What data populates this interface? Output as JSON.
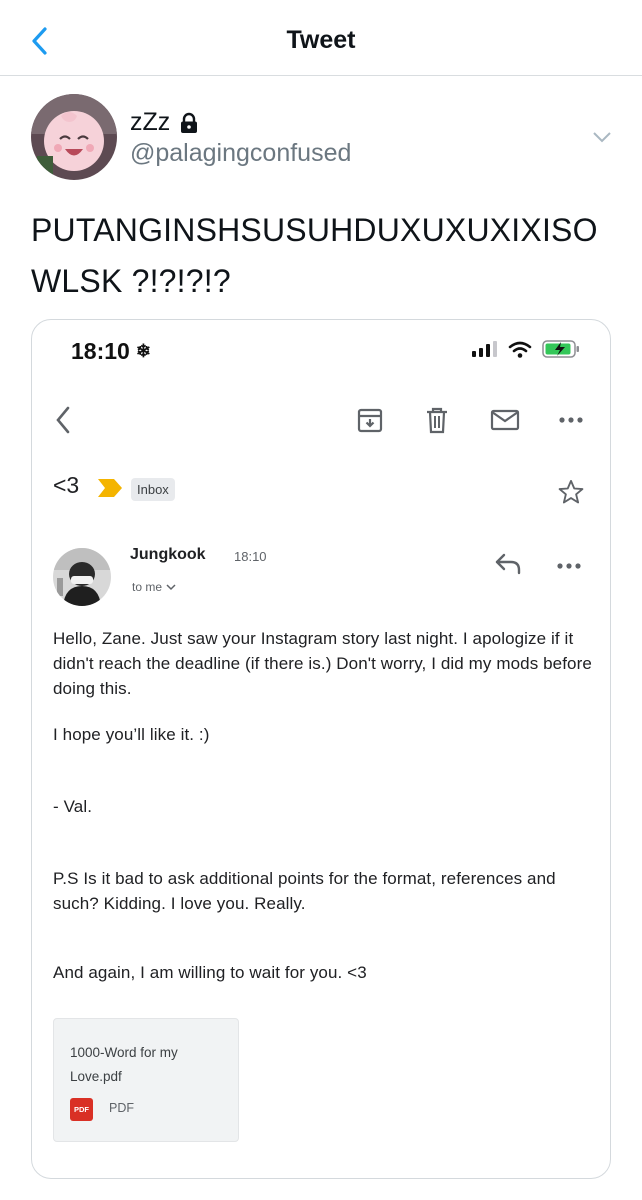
{
  "header": {
    "title": "Tweet",
    "back_icon": "chevron-left-icon"
  },
  "author": {
    "name": "zZz",
    "handle": "@palagingconfused",
    "protected_icon": "lock-icon"
  },
  "tweet": {
    "line1": "PUTANGINSHSUSUHDUXUXUXIXISO",
    "line2": "WLSK ?!?!?!?"
  },
  "screenshot": {
    "status": {
      "time": "18:10",
      "snow_glyph": "❄"
    },
    "email": {
      "subject": "<3",
      "label": "Inbox",
      "sender": "Jungkook",
      "time": "18:10",
      "to": "to me",
      "paragraphs": [
        "Hello, Zane. Just saw your Instagram story last night. I apologize if it didn't reach the deadline (if there is.) Don't worry, I did my mods before doing this.",
        "I hope you’ll like it. :)",
        "- Val.",
        "P.S Is it bad to ask additional points for the format, references and such? Kidding. I love you. Really.",
        "And again, I am willing to wait for you. <3"
      ],
      "attachment": {
        "filename": "1000-Word for my Love.pdf",
        "badge": "PDF",
        "type": "PDF"
      }
    }
  },
  "colors": {
    "accent": "#1d9bf0",
    "label_arrow": "#f4b400",
    "pdf_red": "#d93025",
    "battery_green": "#34c759"
  }
}
